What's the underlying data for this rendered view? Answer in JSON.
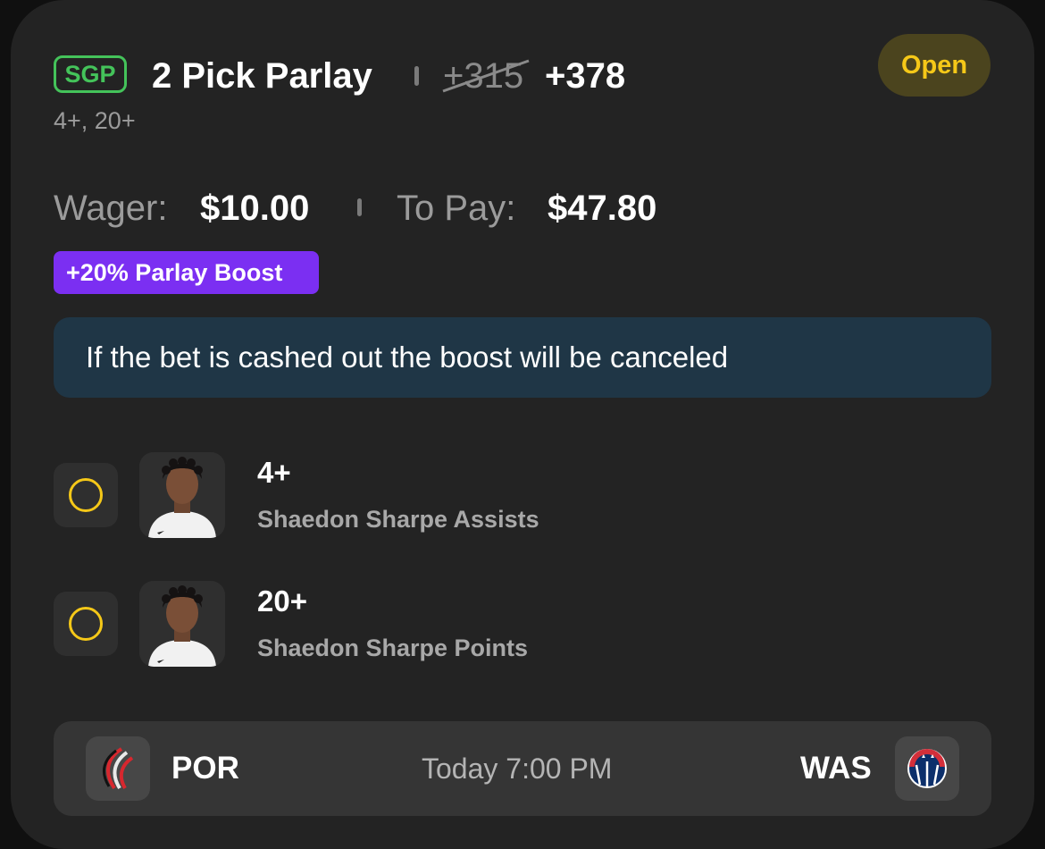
{
  "bet": {
    "badge": "SGP",
    "title": "2 Pick Parlay",
    "original_odds": "+315",
    "boosted_odds": "+378",
    "subtitle": "4+, 20+",
    "status": "Open"
  },
  "wager": {
    "wager_label": "Wager:",
    "wager_value": "$10.00",
    "pay_label": "To Pay:",
    "pay_value": "$47.80"
  },
  "boost": {
    "label": "+20% Parlay Boost",
    "notice": "If the bet is cashed out the boost will be canceled"
  },
  "legs": [
    {
      "line": "4+",
      "market": "Shaedon Sharpe Assists"
    },
    {
      "line": "20+",
      "market": "Shaedon Sharpe Points"
    }
  ],
  "game": {
    "home_team": "POR",
    "time": "Today 7:00 PM",
    "away_team": "WAS"
  },
  "colors": {
    "sgp_green": "#44c35a",
    "open_yellow": "#f5c818",
    "boost_purple": "#7b2ff2",
    "notice_blue": "#1f3646"
  },
  "icons": {
    "leg_status": "empty-circle-icon",
    "por_logo": "trail-blazers-logo-icon",
    "was_logo": "wizards-logo-icon"
  }
}
